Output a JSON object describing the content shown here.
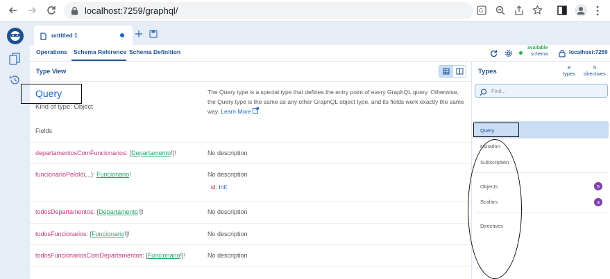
{
  "browser": {
    "url": "localhost:7259/graphql/"
  },
  "tab": {
    "title": "untitled 1"
  },
  "subnav": {
    "operations": "Operations",
    "schema_reference": "Schema Reference",
    "schema_definition": "Schema Definition",
    "status_available": "available",
    "status_schema": "schema",
    "endpoint": "localhost:7259"
  },
  "type_view": {
    "header": "Type View",
    "type_name": "Query",
    "kind": "Kind of type: Object",
    "description": "The Query type is a special type that defines the entry point of every GraphQL query. Otherwise, the Query type is the same as any other GraphQL object type, and its fields work exactly the same way.",
    "learn_more": "Learn More",
    "fields_label": "Fields"
  },
  "fields": [
    {
      "name": "departamentosComFuncionarios",
      "args": "",
      "type_open": "[",
      "type_name": "Departamento",
      "type_close": "!]!",
      "description": "No description"
    },
    {
      "name": "funcionarioPeloId",
      "args": "(...)",
      "type_open": "",
      "type_name": "Funcionario",
      "type_close": "!",
      "description": "No description",
      "arg_name": "id",
      "arg_type": "Int!"
    },
    {
      "name": "todosDepartamentos",
      "args": "",
      "type_open": "[",
      "type_name": "Departamento",
      "type_close": "!]!",
      "description": "No description"
    },
    {
      "name": "todosFuncionarios",
      "args": "",
      "type_open": "[",
      "type_name": "Funcionario",
      "type_close": "!]!",
      "description": "No description"
    },
    {
      "name": "todosFuncionariosComDepartamentos",
      "args": "",
      "type_open": "[",
      "type_name": "Funcionario",
      "type_close": "!]!",
      "description": "No description"
    }
  ],
  "types_panel": {
    "title": "Types",
    "types_count": "8",
    "types_label": "types",
    "directives_count": "5",
    "directives_label": "directives",
    "search_placeholder": "Find...",
    "items": {
      "query": "Query",
      "mutation": "Mutation",
      "subscription": "Subscription",
      "objects": "Objects",
      "objects_count": "5",
      "scalars": "Scalars",
      "scalars_count": "3",
      "directives": "Directives"
    }
  },
  "colors": {
    "accent": "#1d4f91",
    "field_name": "#c2387b",
    "type_link": "#22a36a",
    "selected_bg": "#c9ddf5",
    "badge": "#7e3fa8",
    "status_green": "#2fa84f"
  }
}
